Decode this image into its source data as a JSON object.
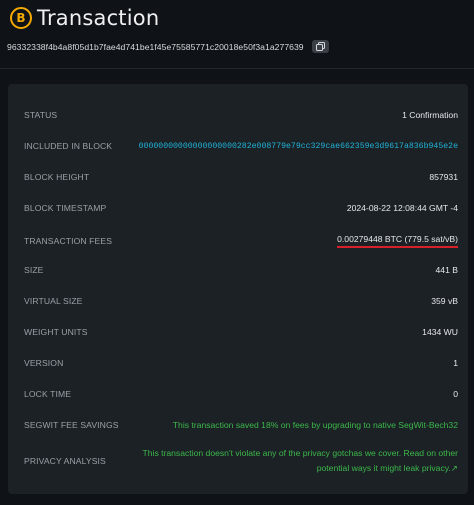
{
  "header": {
    "coin_symbol": "B",
    "title": "Transaction"
  },
  "txid": "96332338f4b4a8f05d1b7fae4d741be1f45e75585771c20018e50f3a1a277639",
  "details": {
    "status": {
      "label": "STATUS",
      "value": "1 Confirmation"
    },
    "included_in_block": {
      "label": "INCLUDED IN BLOCK",
      "value": "00000000000000000000282e008779e79cc329cae662359e3d9617a836b945e2e"
    },
    "block_height": {
      "label": "BLOCK HEIGHT",
      "value": "857931"
    },
    "block_timestamp": {
      "label": "BLOCK TIMESTAMP",
      "value": "2024-08-22 12:08:44 GMT -4"
    },
    "transaction_fees": {
      "label": "TRANSACTION FEES",
      "value": "0.00279448 BTC (779.5 sat/vB)"
    },
    "size": {
      "label": "SIZE",
      "value": "441 B"
    },
    "virtual_size": {
      "label": "VIRTUAL SIZE",
      "value": "359 vB"
    },
    "weight_units": {
      "label": "WEIGHT UNITS",
      "value": "1434 WU"
    },
    "version": {
      "label": "VERSION",
      "value": "1"
    },
    "lock_time": {
      "label": "LOCK TIME",
      "value": "0"
    },
    "segwit_fee_savings": {
      "label": "SEGWIT FEE SAVINGS",
      "value": "This transaction saved 18% on fees by upgrading to native SegWit-Bech32"
    },
    "privacy_analysis": {
      "label": "PRIVACY ANALYSIS",
      "line1": "This transaction doesn't violate any of the privacy gotchas we cover. Read on other",
      "line2": "potential ways it might leak privacy.↗"
    }
  },
  "colors": {
    "accent_link": "#1fb3d6",
    "positive": "#3cb84a",
    "highlight_underline": "#d8202a",
    "coin": "#f2a900"
  },
  "icons": {
    "coin": "bitcoin-coin-icon",
    "copy": "copy-icon"
  }
}
